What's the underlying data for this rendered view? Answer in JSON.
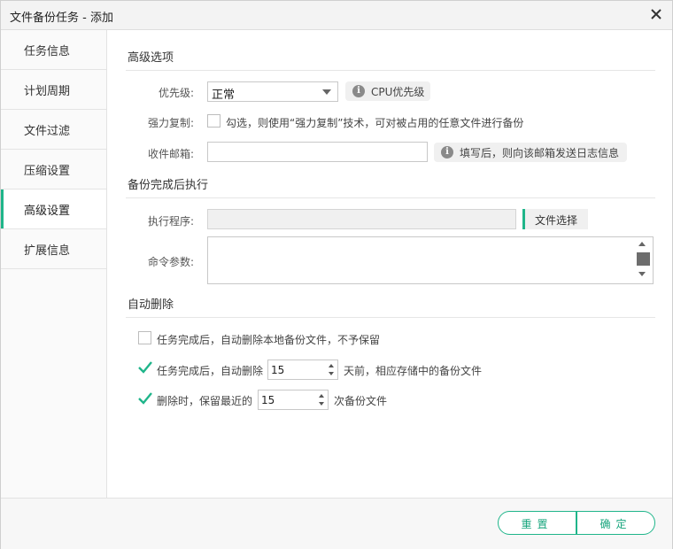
{
  "window": {
    "title": "文件备份任务 - 添加"
  },
  "sidebar": {
    "items": [
      {
        "label": "任务信息"
      },
      {
        "label": "计划周期"
      },
      {
        "label": "文件过滤"
      },
      {
        "label": "压缩设置"
      },
      {
        "label": "高级设置",
        "active": true
      },
      {
        "label": "扩展信息"
      }
    ]
  },
  "advanced": {
    "section_title": "高级选项",
    "priority_label": "优先级:",
    "priority_value": "正常",
    "cpu_priority_label": "CPU优先级",
    "force_copy_label": "强力复制:",
    "force_copy_text": "勾选，则使用“强力复制”技术，可对被占用的任意文件进行备份",
    "force_copy_checked": false,
    "email_label": "收件邮箱:",
    "email_value": "",
    "email_tip": "填写后，则向该邮箱发送日志信息"
  },
  "post_exec": {
    "section_title": "备份完成后执行",
    "program_label": "执行程序:",
    "program_value": "",
    "file_select_label": "文件选择",
    "args_label": "命令参数:",
    "args_value": ""
  },
  "auto_delete": {
    "section_title": "自动删除",
    "opt1_text": "任务完成后，自动删除本地备份文件，不予保留",
    "opt1_checked": false,
    "opt2_text_before": "任务完成后，自动删除",
    "opt2_days": "15",
    "opt2_text_after": "天前，相应存储中的备份文件",
    "opt2_checked": true,
    "opt3_text_before": "删除时，保留最近的",
    "opt3_count": "15",
    "opt3_text_after": "次备份文件",
    "opt3_checked": true
  },
  "footer": {
    "reset_label": "重置",
    "ok_label": "确定"
  },
  "colors": {
    "accent": "#1fb58a",
    "sidebar_bg": "#fafafa",
    "tip_bg": "#f0f0f0"
  },
  "icons": {
    "close": "close-icon",
    "info": "info-icon",
    "check": "checkmark-icon"
  }
}
